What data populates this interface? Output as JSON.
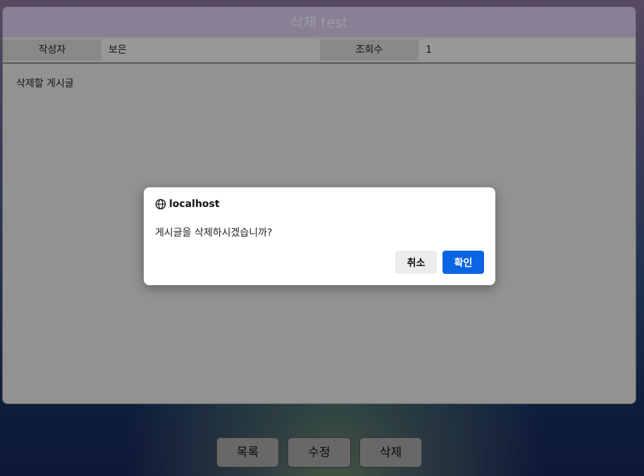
{
  "post": {
    "title": "삭제 test",
    "author_label": "작성자",
    "author_value": "보은",
    "views_label": "조회수",
    "views_value": "1",
    "content": "삭제할 게시글"
  },
  "bottom_buttons": {
    "list": "목록",
    "edit": "수정",
    "delete": "삭제"
  },
  "dialog": {
    "origin": "localhost",
    "origin_icon": "globe-icon",
    "message": "게시글을 삭제하시겠습니까?",
    "cancel": "취소",
    "confirm": "확인"
  },
  "colors": {
    "title_bar": "#dcd0f2",
    "confirm_button": "#0b64e4"
  }
}
